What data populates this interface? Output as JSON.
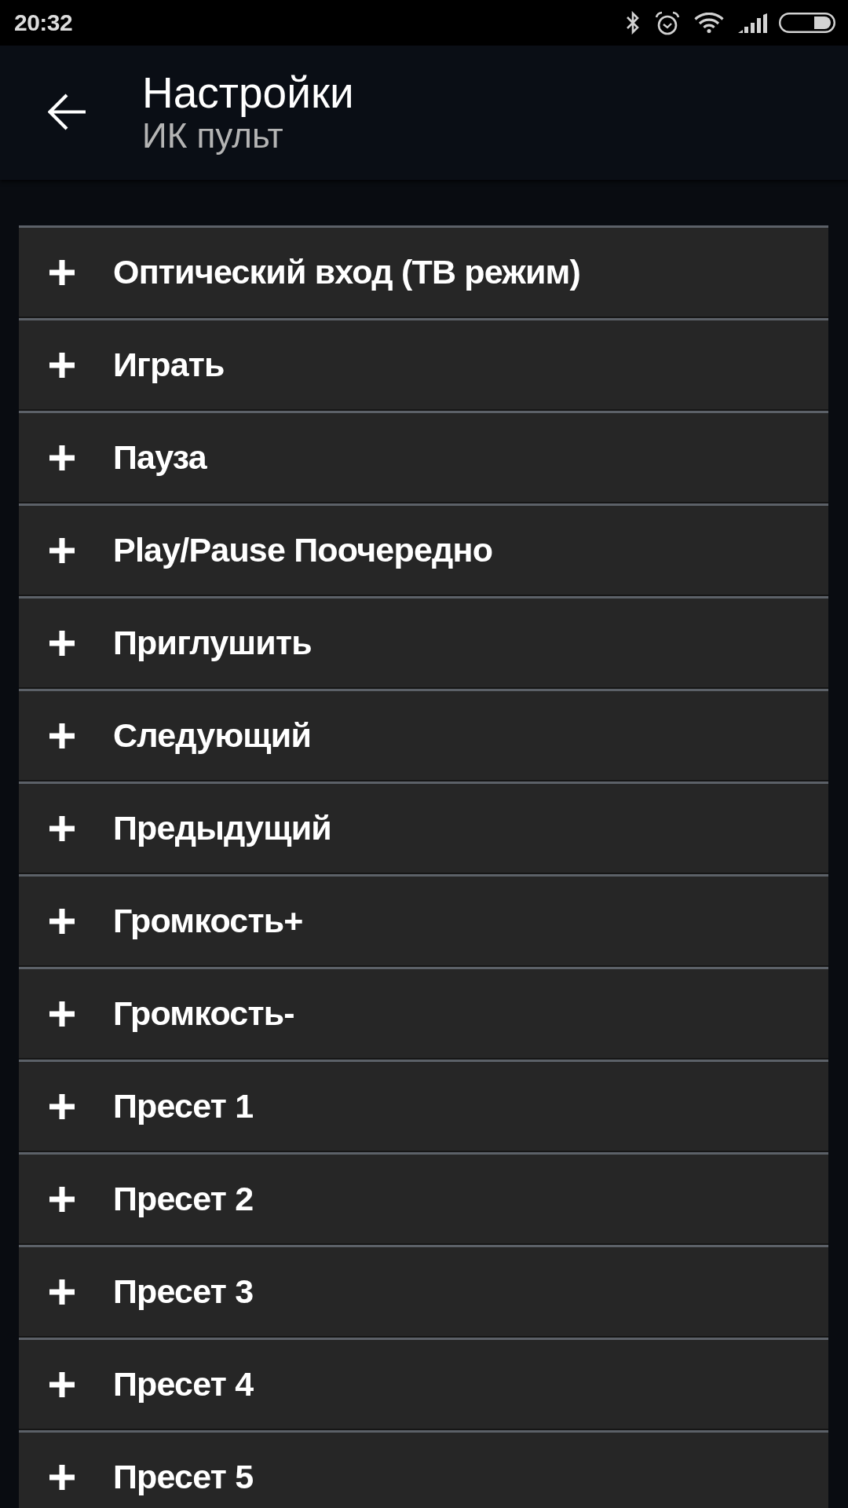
{
  "status_bar": {
    "time": "20:32"
  },
  "app_bar": {
    "title": "Настройки",
    "subtitle": "ИК пульт"
  },
  "commands": [
    {
      "label": "Оптический вход (ТВ режим)",
      "expanded": false
    },
    {
      "label": "Играть",
      "expanded": false
    },
    {
      "label": "Пауза",
      "expanded": false
    },
    {
      "label": "Play/Pause Поочередно",
      "expanded": false
    },
    {
      "label": "Приглушить",
      "expanded": false
    },
    {
      "label": "Следующий",
      "expanded": false
    },
    {
      "label": "Предыдущий",
      "expanded": false
    },
    {
      "label": "Громкость+",
      "expanded": false
    },
    {
      "label": "Громкость-",
      "expanded": false
    },
    {
      "label": "Пресет 1",
      "expanded": false
    },
    {
      "label": "Пресет 2",
      "expanded": false
    },
    {
      "label": "Пресет 3",
      "expanded": false
    },
    {
      "label": "Пресет 4",
      "expanded": false
    },
    {
      "label": "Пресет 5",
      "expanded": false
    }
  ]
}
